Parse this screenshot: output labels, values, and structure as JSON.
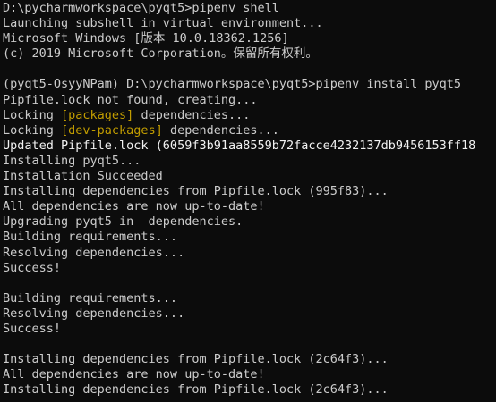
{
  "theme": {
    "background": "#0c0c0c",
    "foreground": "#cccccc",
    "bright_foreground": "#f2f2f2",
    "accent_yellow": "#c19c00"
  },
  "lines": [
    [
      {
        "t": "D:\\pycharmworkspace\\pyqt5>pipenv shell",
        "c": "normal"
      }
    ],
    [
      {
        "t": "Launching subshell in virtual environment...",
        "c": "normal"
      }
    ],
    [
      {
        "t": "Microsoft Windows [版本 10.0.18362.1256]",
        "c": "normal"
      }
    ],
    [
      {
        "t": "(c) 2019 Microsoft Corporation。保留所有权利。",
        "c": "normal"
      }
    ],
    [
      {
        "t": "",
        "c": "normal"
      }
    ],
    [
      {
        "t": "(pyqt5-OsyyNPam) D:\\pycharmworkspace\\pyqt5>pipenv install pyqt5",
        "c": "normal"
      }
    ],
    [
      {
        "t": "Pipfile.lock not found, creating...",
        "c": "normal"
      }
    ],
    [
      {
        "t": "Locking ",
        "c": "normal"
      },
      {
        "t": "[packages]",
        "c": "yellow"
      },
      {
        "t": " dependencies...",
        "c": "normal"
      }
    ],
    [
      {
        "t": "Locking ",
        "c": "normal"
      },
      {
        "t": "[dev-packages]",
        "c": "yellow"
      },
      {
        "t": " dependencies...",
        "c": "normal"
      }
    ],
    [
      {
        "t": "Updated Pipfile.lock (6059f3b91aa8559b72facce4232137db9456153ff18",
        "c": "bright"
      }
    ],
    [
      {
        "t": "Installing pyqt5...",
        "c": "normal"
      }
    ],
    [
      {
        "t": "Installation Succeeded",
        "c": "normal"
      }
    ],
    [
      {
        "t": "Installing dependencies from Pipfile.lock (995f83)...",
        "c": "normal"
      }
    ],
    [
      {
        "t": "All dependencies are now up-to-date!",
        "c": "normal"
      }
    ],
    [
      {
        "t": "Upgrading pyqt5 in  dependencies.",
        "c": "normal"
      }
    ],
    [
      {
        "t": "Building requirements...",
        "c": "normal"
      }
    ],
    [
      {
        "t": "Resolving dependencies...",
        "c": "normal"
      }
    ],
    [
      {
        "t": "Success!",
        "c": "normal"
      }
    ],
    [
      {
        "t": "",
        "c": "normal"
      }
    ],
    [
      {
        "t": "Building requirements...",
        "c": "normal"
      }
    ],
    [
      {
        "t": "Resolving dependencies...",
        "c": "normal"
      }
    ],
    [
      {
        "t": "Success!",
        "c": "normal"
      }
    ],
    [
      {
        "t": "",
        "c": "normal"
      }
    ],
    [
      {
        "t": "Installing dependencies from Pipfile.lock (2c64f3)...",
        "c": "normal"
      }
    ],
    [
      {
        "t": "All dependencies are now up-to-date!",
        "c": "normal"
      }
    ],
    [
      {
        "t": "Installing dependencies from Pipfile.lock (2c64f3)...",
        "c": "normal"
      }
    ]
  ]
}
